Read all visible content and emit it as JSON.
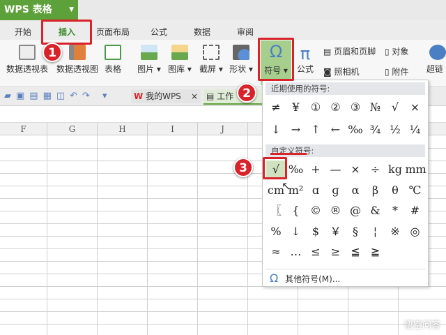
{
  "app": {
    "title": "WPS 表格"
  },
  "tabs": [
    "开始",
    "插入",
    "页面布局",
    "公式",
    "数据",
    "审阅"
  ],
  "ribbon": {
    "pivot_table": "数据透视表",
    "pivot_chart": "数据透视图",
    "table": "表格",
    "picture": "图片 ▾",
    "gallery": "图库 ▾",
    "screenshot": "截屏 ▾",
    "shape": "形状 ▾",
    "symbol": "符号 ▾",
    "formula": "公式",
    "header_footer": "页眉和页脚",
    "object": "对象",
    "camera": "照相机",
    "attachment": "附件",
    "hyperlink": "超链"
  },
  "doc_tabs": {
    "my_wps": "我的WPS",
    "close": "×",
    "workbook": "工作"
  },
  "columns": [
    "F",
    "G",
    "H",
    "I",
    "J"
  ],
  "symbol_menu": {
    "recent_header": "近期使用的符号:",
    "recent": [
      "≠",
      "¥",
      "①",
      "②",
      "③",
      "№",
      "√",
      "×",
      "↓",
      "→",
      "↑",
      "←",
      "‰",
      "¾",
      "½",
      "¼"
    ],
    "custom_header": "自定义符号:",
    "custom": [
      "√",
      "‰",
      "+",
      "—",
      "×",
      "÷",
      "kg",
      "mm",
      "cm",
      "m²",
      "ɑ",
      "ɡ",
      "α",
      "β",
      "θ",
      "℃",
      "〖",
      "{",
      "©",
      "®",
      "@",
      "&",
      "*",
      "#",
      "%",
      "↓",
      "$",
      "￥",
      "§",
      "¦",
      "※",
      "◎",
      "≈",
      "…",
      "≤",
      "≥",
      "≦",
      "≧"
    ],
    "more": "其他符号(M)..."
  },
  "badges": [
    "1",
    "2",
    "3"
  ],
  "watermark": "悟空问答",
  "colors": {
    "green": "#5da13a",
    "red": "#d9232a"
  }
}
